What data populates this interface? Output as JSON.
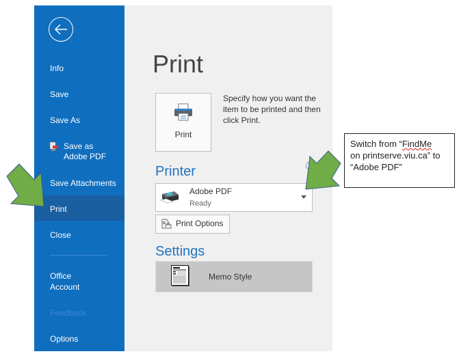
{
  "sidebar": {
    "back_label": "Back",
    "items": [
      {
        "label": "Info"
      },
      {
        "label": "Save"
      },
      {
        "label": "Save As"
      },
      {
        "label_line1": "Save as",
        "label_line2": "Adobe PDF"
      },
      {
        "label": "Save Attachments"
      },
      {
        "label": "Print",
        "active": true
      },
      {
        "label": "Close"
      },
      {
        "label_line1": "Office",
        "label_line2": "Account"
      },
      {
        "label": "Feedback",
        "disabled": true
      },
      {
        "label": "Options"
      }
    ]
  },
  "main": {
    "title": "Print",
    "print_button_label": "Print",
    "description": "Specify how you want the item to be printed and then click Print.",
    "printer_heading": "Printer",
    "printer": {
      "name": "Adobe PDF",
      "status": "Ready"
    },
    "info_glyph": "i",
    "print_options_label": "Print Options",
    "settings_heading": "Settings",
    "style_label": "Memo Style"
  },
  "annotation": {
    "prefix": "Switch from “",
    "misspelled_word": "FindMe",
    "rest_line2": "on printserve.viu.ca” to",
    "line3": "“Adobe PDF”",
    "arrow_color": "#70ad47"
  },
  "colors": {
    "sidebar": "#106ebe",
    "accent": "#1f73c3",
    "background": "#f0f0f0"
  }
}
